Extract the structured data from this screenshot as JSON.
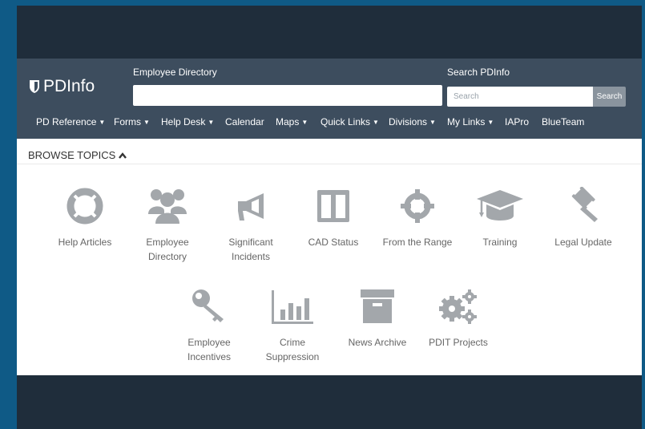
{
  "header": {
    "logo": "PDInfo",
    "directory_label": "Employee Directory",
    "search_label": "Search PDInfo",
    "search_placeholder": "Search",
    "search_button": "Search"
  },
  "nav": [
    {
      "label": "PD Reference",
      "dropdown": true
    },
    {
      "label": "Forms",
      "dropdown": true
    },
    {
      "label": "Help Desk",
      "dropdown": true
    },
    {
      "label": "Calendar",
      "dropdown": false
    },
    {
      "label": "Maps",
      "dropdown": true
    },
    {
      "label": "Quick Links",
      "dropdown": true
    },
    {
      "label": "Divisions",
      "dropdown": true
    },
    {
      "label": "My Links",
      "dropdown": true
    },
    {
      "label": "IAPro",
      "dropdown": false
    },
    {
      "label": "BlueTeam",
      "dropdown": false
    }
  ],
  "browse": {
    "heading": "BROWSE TOPICS",
    "topics": [
      {
        "label": "Help Articles",
        "icon": "life-ring-icon"
      },
      {
        "label": "Employee\nDirectory",
        "icon": "users-icon"
      },
      {
        "label": "Significant\nIncidents",
        "icon": "megaphone-icon"
      },
      {
        "label": "CAD Status",
        "icon": "columns-icon"
      },
      {
        "label": "From the Range",
        "icon": "crosshairs-icon"
      },
      {
        "label": "Training",
        "icon": "graduation-cap-icon"
      },
      {
        "label": "Legal Update",
        "icon": "gavel-icon"
      },
      {
        "label": "Employee\nIncentives",
        "icon": "key-icon"
      },
      {
        "label": "Crime\nSuppression",
        "icon": "bar-chart-icon"
      },
      {
        "label": "News Archive",
        "icon": "archive-icon"
      },
      {
        "label": "PDIT Projects",
        "icon": "gears-icon"
      }
    ]
  },
  "colors": {
    "outer_background": "#0f5a86",
    "header_background": "#3d4d5e",
    "frame_dark": "#1f2d3b",
    "icon_gray": "#a3a7ab"
  }
}
